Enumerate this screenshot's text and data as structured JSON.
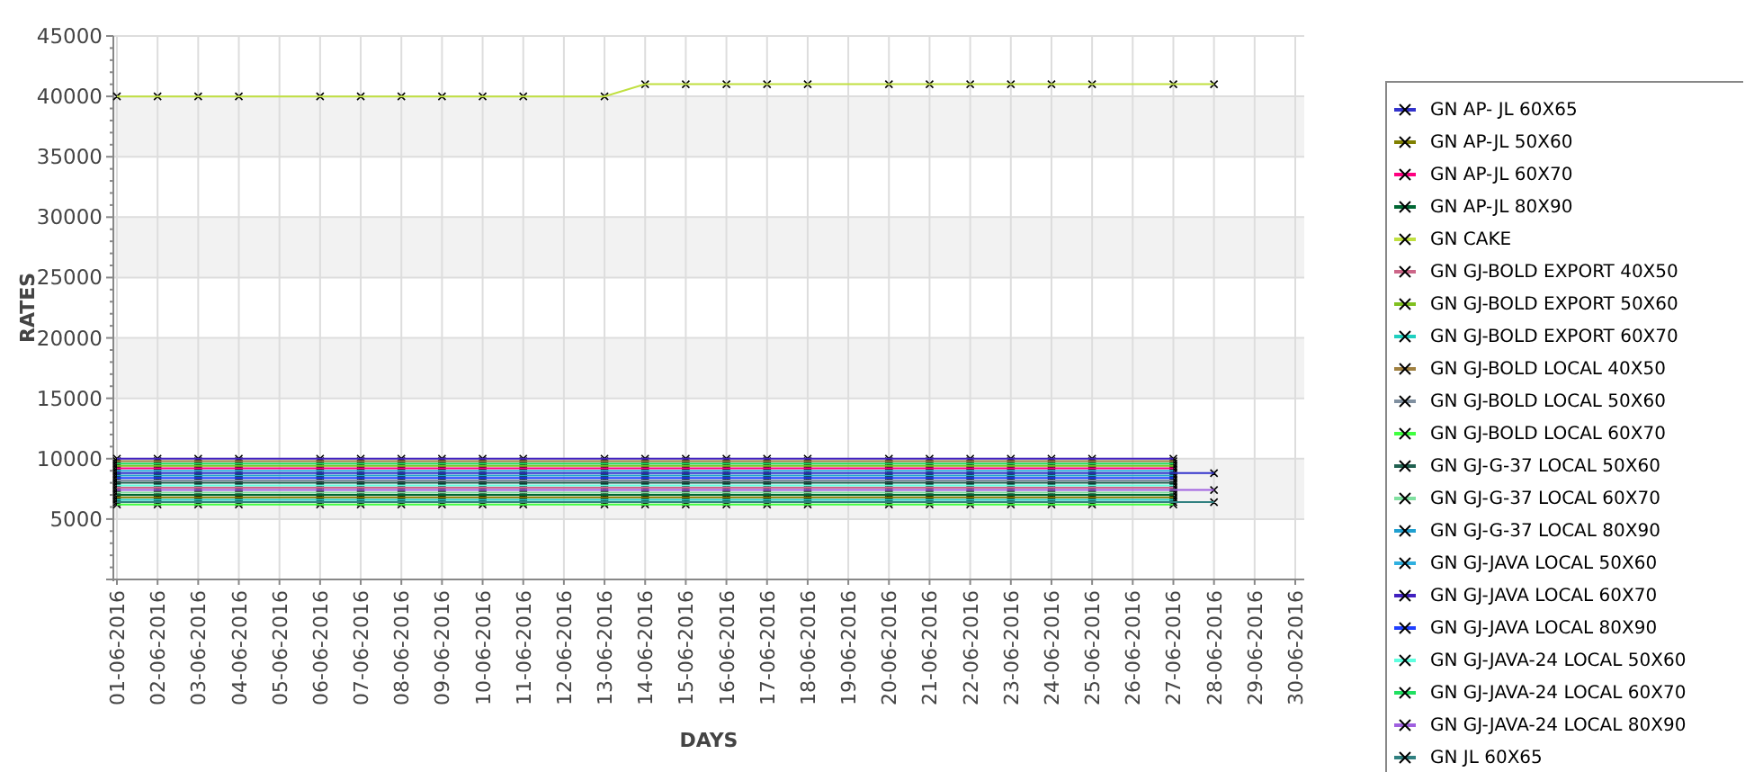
{
  "chart": {
    "chart_data": {
      "type": "line",
      "grid": true,
      "xlabel": "DAYS",
      "ylabel": "RATES",
      "ylim": [
        0,
        45000
      ],
      "yticks": [
        5000,
        10000,
        15000,
        20000,
        25000,
        30000,
        35000,
        40000,
        45000
      ],
      "categories": [
        "01-06-2016",
        "02-06-2016",
        "03-06-2016",
        "04-06-2016",
        "05-06-2016",
        "06-06-2016",
        "07-06-2016",
        "08-06-2016",
        "09-06-2016",
        "10-06-2016",
        "11-06-2016",
        "12-06-2016",
        "13-06-2016",
        "14-06-2016",
        "15-06-2016",
        "16-06-2016",
        "17-06-2016",
        "18-06-2016",
        "19-06-2016",
        "20-06-2016",
        "21-06-2016",
        "22-06-2016",
        "23-06-2016",
        "24-06-2016",
        "25-06-2016",
        "26-06-2016",
        "27-06-2016",
        "28-06-2016",
        "29-06-2016",
        "30-06-2016"
      ],
      "series": [
        {
          "name": "GN AP- JL 60X65",
          "color": "#3333cc",
          "marker": "x",
          "values": [
            8800,
            8800,
            8800,
            8800,
            null,
            8800,
            8800,
            8800,
            8800,
            8800,
            8800,
            null,
            8800,
            8800,
            8800,
            8800,
            8800,
            8800,
            null,
            8800,
            8800,
            8800,
            8800,
            8800,
            8800,
            null,
            8800,
            8800,
            null,
            null
          ]
        },
        {
          "name": "GN AP-JL 50X60",
          "color": "#808000",
          "marker": "x",
          "values": [
            6800,
            6800,
            6800,
            6800,
            null,
            6800,
            6800,
            6800,
            6800,
            6800,
            6800,
            null,
            6800,
            6800,
            6800,
            6800,
            6800,
            6800,
            null,
            6800,
            6800,
            6800,
            6800,
            6800,
            6800,
            null,
            6800,
            null,
            null,
            null
          ]
        },
        {
          "name": "GN AP-JL 60X70",
          "color": "#ff0080",
          "marker": "x",
          "values": [
            9200,
            9200,
            9200,
            9200,
            null,
            9200,
            9200,
            9200,
            9200,
            9200,
            9200,
            null,
            9200,
            9200,
            9200,
            9200,
            9200,
            9200,
            null,
            9200,
            9200,
            9200,
            9200,
            9200,
            9200,
            null,
            9200,
            null,
            null,
            null
          ]
        },
        {
          "name": "GN AP-JL 80X90",
          "color": "#006633",
          "marker": "x",
          "values": [
            7000,
            7000,
            7000,
            7000,
            null,
            7000,
            7000,
            7000,
            7000,
            7000,
            7000,
            null,
            7000,
            7000,
            7000,
            7000,
            7000,
            7000,
            null,
            7000,
            7000,
            7000,
            7000,
            7000,
            7000,
            null,
            7000,
            null,
            null,
            null
          ]
        },
        {
          "name": "GN CAKE",
          "color": "#c0e040",
          "marker": "x",
          "values": [
            40000,
            40000,
            40000,
            40000,
            null,
            40000,
            40000,
            40000,
            40000,
            40000,
            40000,
            null,
            40000,
            41000,
            41000,
            41000,
            41000,
            41000,
            null,
            41000,
            41000,
            41000,
            41000,
            41000,
            41000,
            null,
            41000,
            41000,
            null,
            null
          ]
        },
        {
          "name": "GN GJ-BOLD EXPORT 40X50",
          "color": "#cc6688",
          "marker": "x",
          "values": [
            7600,
            7600,
            7600,
            7600,
            null,
            7600,
            7600,
            7600,
            7600,
            7600,
            7600,
            null,
            7600,
            7600,
            7600,
            7600,
            7600,
            7600,
            null,
            7600,
            7600,
            7600,
            7600,
            7600,
            7600,
            null,
            7600,
            null,
            null,
            null
          ]
        },
        {
          "name": "GN GJ-BOLD EXPORT 50X60",
          "color": "#80c020",
          "marker": "x",
          "values": [
            9400,
            9400,
            9400,
            9400,
            null,
            9400,
            9400,
            9400,
            9400,
            9400,
            9400,
            null,
            9400,
            9400,
            9400,
            9400,
            9400,
            9400,
            null,
            9400,
            9400,
            9400,
            9400,
            9400,
            9400,
            null,
            9400,
            null,
            null,
            null
          ]
        },
        {
          "name": "GN GJ-BOLD EXPORT 60X70",
          "color": "#20d0c0",
          "marker": "x",
          "values": [
            6600,
            6600,
            6600,
            6600,
            null,
            6600,
            6600,
            6600,
            6600,
            6600,
            6600,
            null,
            6600,
            6600,
            6600,
            6600,
            6600,
            6600,
            null,
            6600,
            6600,
            6600,
            6600,
            6600,
            6600,
            null,
            6600,
            null,
            null,
            null
          ]
        },
        {
          "name": "GN GJ-BOLD LOCAL 40X50",
          "color": "#a08040",
          "marker": "x",
          "values": [
            9800,
            9800,
            9800,
            9800,
            null,
            9800,
            9800,
            9800,
            9800,
            9800,
            9800,
            null,
            9800,
            9800,
            9800,
            9800,
            9800,
            9800,
            null,
            9800,
            9800,
            9800,
            9800,
            9800,
            9800,
            null,
            9800,
            null,
            null,
            null
          ]
        },
        {
          "name": "GN GJ-BOLD LOCAL 50X60",
          "color": "#8090a0",
          "marker": "x",
          "values": [
            8200,
            8200,
            8200,
            8200,
            null,
            8200,
            8200,
            8200,
            8200,
            8200,
            8200,
            null,
            8200,
            8200,
            8200,
            8200,
            8200,
            8200,
            null,
            8200,
            8200,
            8200,
            8200,
            8200,
            8200,
            null,
            8200,
            null,
            null,
            null
          ]
        },
        {
          "name": "GN GJ-BOLD LOCAL 60X70",
          "color": "#40ff40",
          "marker": "x",
          "values": [
            6200,
            6200,
            6200,
            6200,
            null,
            6200,
            6200,
            6200,
            6200,
            6200,
            6200,
            null,
            6200,
            6200,
            6200,
            6200,
            6200,
            6200,
            null,
            6200,
            6200,
            6200,
            6200,
            6200,
            6200,
            null,
            6200,
            null,
            null,
            null
          ]
        },
        {
          "name": "GN GJ-G-37 LOCAL 50X60",
          "color": "#206050",
          "marker": "x",
          "values": [
            8000,
            8000,
            8000,
            8000,
            null,
            8000,
            8000,
            8000,
            8000,
            8000,
            8000,
            null,
            8000,
            8000,
            8000,
            8000,
            8000,
            8000,
            null,
            8000,
            8000,
            8000,
            8000,
            8000,
            8000,
            null,
            8000,
            null,
            null,
            null
          ]
        },
        {
          "name": "GN GJ-G-37 LOCAL 60X70",
          "color": "#80e0a0",
          "marker": "x",
          "values": [
            7200,
            7200,
            7200,
            7200,
            null,
            7200,
            7200,
            7200,
            7200,
            7200,
            7200,
            null,
            7200,
            7200,
            7200,
            7200,
            7200,
            7200,
            null,
            7200,
            7200,
            7200,
            7200,
            7200,
            7200,
            null,
            7200,
            null,
            null,
            null
          ]
        },
        {
          "name": "GN GJ-G-37 LOCAL 80X90",
          "color": "#20a0d0",
          "marker": "x",
          "values": [
            8600,
            8600,
            8600,
            8600,
            null,
            8600,
            8600,
            8600,
            8600,
            8600,
            8600,
            null,
            8600,
            8600,
            8600,
            8600,
            8600,
            8600,
            null,
            8600,
            8600,
            8600,
            8600,
            8600,
            8600,
            null,
            8600,
            null,
            null,
            null
          ]
        },
        {
          "name": "GN GJ-JAVA LOCAL 50X60",
          "color": "#30b0e0",
          "marker": "x",
          "values": [
            9000,
            9000,
            9000,
            9000,
            null,
            9000,
            9000,
            9000,
            9000,
            9000,
            9000,
            null,
            9000,
            9000,
            9000,
            9000,
            9000,
            9000,
            null,
            9000,
            9000,
            9000,
            9000,
            9000,
            9000,
            null,
            9000,
            null,
            null,
            null
          ]
        },
        {
          "name": "GN GJ-JAVA LOCAL 60X70",
          "color": "#4020c0",
          "marker": "x",
          "values": [
            10000,
            10000,
            10000,
            10000,
            null,
            10000,
            10000,
            10000,
            10000,
            10000,
            10000,
            null,
            10000,
            10000,
            10000,
            10000,
            10000,
            10000,
            null,
            10000,
            10000,
            10000,
            10000,
            10000,
            10000,
            null,
            10000,
            null,
            null,
            null
          ]
        },
        {
          "name": "GN GJ-JAVA LOCAL 80X90",
          "color": "#2040ff",
          "marker": "x",
          "values": [
            8400,
            8400,
            8400,
            8400,
            null,
            8400,
            8400,
            8400,
            8400,
            8400,
            8400,
            null,
            8400,
            8400,
            8400,
            8400,
            8400,
            8400,
            null,
            8400,
            8400,
            8400,
            8400,
            8400,
            8400,
            null,
            8400,
            null,
            null,
            null
          ]
        },
        {
          "name": "GN GJ-JAVA-24 LOCAL 50X60",
          "color": "#60ffe0",
          "marker": "x",
          "values": [
            7800,
            7800,
            7800,
            7800,
            null,
            7800,
            7800,
            7800,
            7800,
            7800,
            7800,
            null,
            7800,
            7800,
            7800,
            7800,
            7800,
            7800,
            null,
            7800,
            7800,
            7800,
            7800,
            7800,
            7800,
            null,
            7800,
            null,
            null,
            null
          ]
        },
        {
          "name": "GN GJ-JAVA-24 LOCAL 60X70",
          "color": "#20e060",
          "marker": "x",
          "values": [
            9600,
            9600,
            9600,
            9600,
            null,
            9600,
            9600,
            9600,
            9600,
            9600,
            9600,
            null,
            9600,
            9600,
            9600,
            9600,
            9600,
            9600,
            null,
            9600,
            9600,
            9600,
            9600,
            9600,
            9600,
            null,
            9600,
            null,
            null,
            null
          ]
        },
        {
          "name": "GN GJ-JAVA-24 LOCAL 80X90",
          "color": "#a060e0",
          "marker": "x",
          "values": [
            7400,
            7400,
            7400,
            7400,
            null,
            7400,
            7400,
            7400,
            7400,
            7400,
            7400,
            null,
            7400,
            7400,
            7400,
            7400,
            7400,
            7400,
            null,
            7400,
            7400,
            7400,
            7400,
            7400,
            7400,
            null,
            7400,
            7400,
            null,
            null
          ]
        },
        {
          "name": "GN JL 60X65",
          "color": "#308080",
          "marker": "x",
          "values": [
            6400,
            6400,
            6400,
            6400,
            null,
            6400,
            6400,
            6400,
            6400,
            6400,
            6400,
            null,
            6400,
            6400,
            6400,
            6400,
            6400,
            6400,
            null,
            6400,
            6400,
            6400,
            6400,
            6400,
            6400,
            null,
            6400,
            6400,
            null,
            null
          ]
        }
      ]
    }
  }
}
